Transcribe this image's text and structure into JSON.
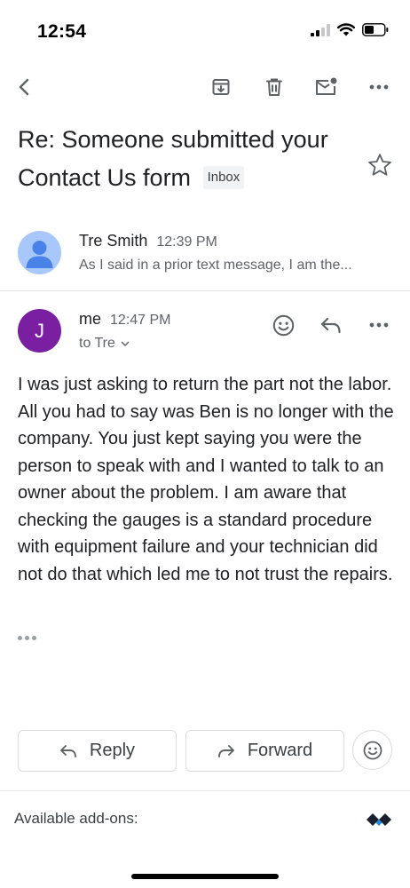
{
  "status_bar": {
    "time": "12:54"
  },
  "toolbar": {
    "back_icon": "chevron-left-icon",
    "archive_icon": "archive-icon",
    "delete_icon": "trash-icon",
    "mark_unread_icon": "mark-unread-icon",
    "more_icon": "more-horizontal-icon"
  },
  "thread": {
    "subject": "Re: Someone submitted your Contact Us form",
    "label": "Inbox",
    "starred": false
  },
  "messages": [
    {
      "sender": "Tre Smith",
      "time": "12:39 PM",
      "snippet": "As I said in a prior text message, I am the...",
      "avatar_color": "#a8c7fa"
    },
    {
      "sender": "me",
      "time": "12:47 PM",
      "to": "to Tre",
      "avatar_letter": "J",
      "avatar_color": "#7b1fa2",
      "body": "I was just asking to return the part not the labor. All you had to say was Ben is no longer with the company. You just kept saying you were the person to speak with and I wanted to talk to an owner about the problem. I am aware that checking the gauges is a standard procedure with equipment failure and your technician did not do that which led me to not trust the repairs."
    }
  ],
  "actions": {
    "reply_label": "Reply",
    "forward_label": "Forward"
  },
  "footer": {
    "addons_label": "Available add-ons:"
  }
}
